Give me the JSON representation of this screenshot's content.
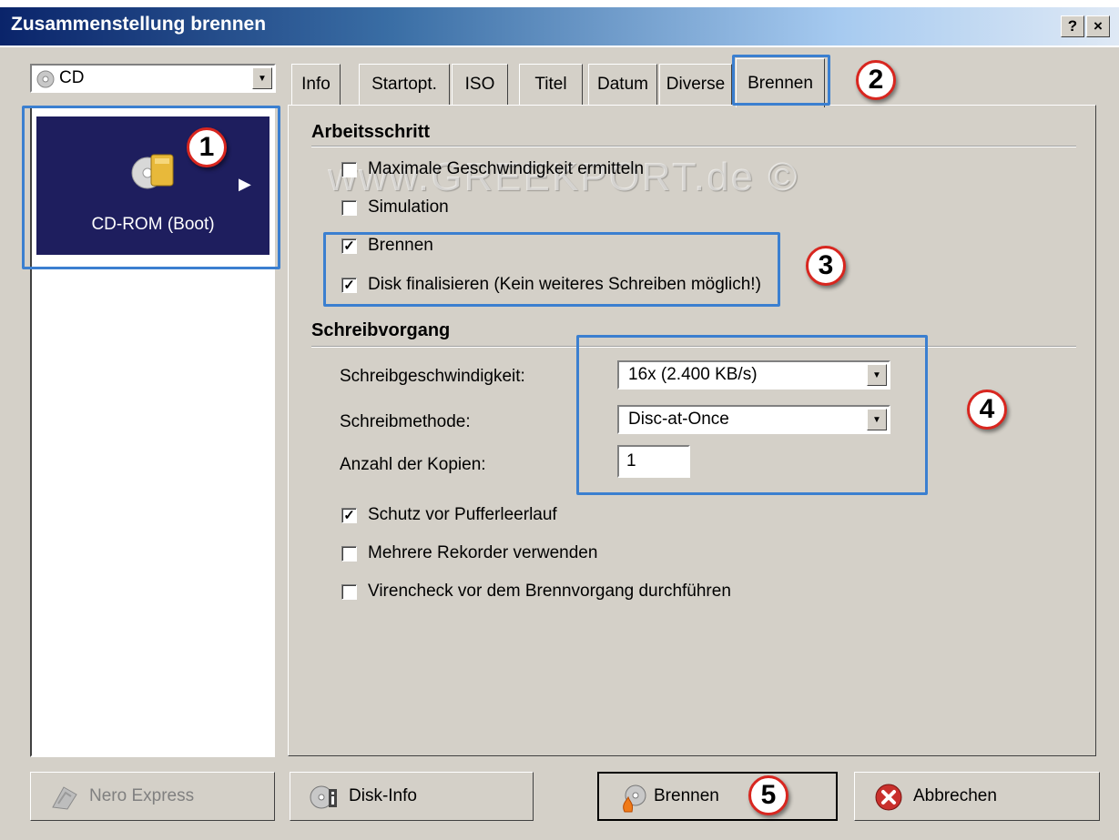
{
  "window": {
    "title": "Zusammenstellung brennen",
    "help_label": "?",
    "close_label": "×"
  },
  "media_select": {
    "value": "CD"
  },
  "left_list": {
    "items": [
      {
        "label": "CD-ROM (Boot)"
      }
    ]
  },
  "tabs": [
    {
      "label": "Info"
    },
    {
      "label": "Startopt."
    },
    {
      "label": "ISO"
    },
    {
      "label": "Titel"
    },
    {
      "label": "Datum"
    },
    {
      "label": "Diverse"
    },
    {
      "label": "Brennen",
      "active": true
    }
  ],
  "arbeitsschritt": {
    "heading": "Arbeitsschritt",
    "options": [
      {
        "label": "Maximale Geschwindigkeit ermitteln",
        "checked": false
      },
      {
        "label": "Simulation",
        "checked": false
      },
      {
        "label": "Brennen",
        "checked": true
      },
      {
        "label": "Disk finalisieren (Kein weiteres Schreiben möglich!)",
        "checked": true
      }
    ]
  },
  "schreibvorgang": {
    "heading": "Schreibvorgang",
    "speed_label": "Schreibgeschwindigkeit:",
    "speed_value": "16x (2.400 KB/s)",
    "method_label": "Schreibmethode:",
    "method_value": "Disc-at-Once",
    "copies_label": "Anzahl der Kopien:",
    "copies_value": "1",
    "options": [
      {
        "label": "Schutz vor Pufferleerlauf",
        "checked": true
      },
      {
        "label": "Mehrere Rekorder verwenden",
        "checked": false
      },
      {
        "label": "Virencheck vor dem Brennvorgang durchführen",
        "checked": false
      }
    ]
  },
  "watermark": "www.GREEKPORT.de ©",
  "annotations": [
    "1",
    "2",
    "3",
    "4",
    "5"
  ],
  "buttons": {
    "nero_express": {
      "label": "Nero Express",
      "enabled": false
    },
    "disk_info": {
      "label": "Disk-Info"
    },
    "brennen": {
      "label": "Brennen"
    },
    "abbrechen": {
      "label": "Abbrechen"
    }
  },
  "colors": {
    "highlight": "#3b7fd0",
    "badge_border": "#d8261f",
    "title_bar": "#0a246a",
    "selected_item": "#1e1e5e"
  }
}
